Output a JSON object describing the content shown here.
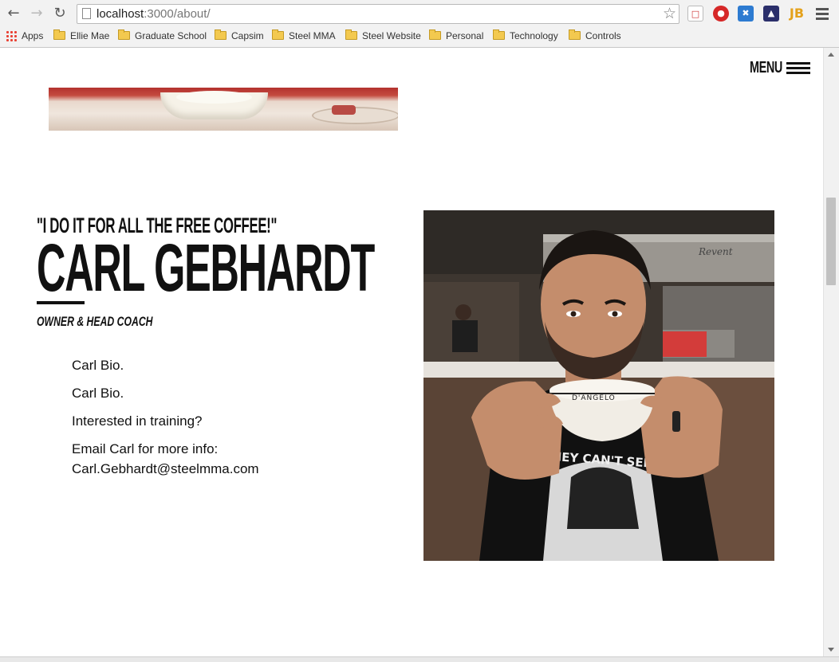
{
  "browser": {
    "url_host": "localhost",
    "url_path": ":3000/about/",
    "bookmarks": [
      {
        "label": "Apps",
        "icon": "apps-grid-icon"
      },
      {
        "label": "Ellie Mae",
        "icon": "folder-icon"
      },
      {
        "label": "Graduate School",
        "icon": "folder-icon"
      },
      {
        "label": "Capsim",
        "icon": "folder-icon"
      },
      {
        "label": "Steel MMA",
        "icon": "folder-icon"
      },
      {
        "label": "Steel Website",
        "icon": "folder-icon"
      },
      {
        "label": "Personal",
        "icon": "folder-icon"
      },
      {
        "label": "Technology",
        "icon": "folder-icon"
      },
      {
        "label": "Controls",
        "icon": "folder-icon"
      }
    ],
    "extensions": [
      "pdf-extension-icon",
      "adblock-icon",
      "x-extension-icon",
      "dark-extension-icon",
      "jetbrains-icon"
    ],
    "jb_label": "JB"
  },
  "nav": {
    "menu_label": "MENU"
  },
  "profile": {
    "quote": "\"I DO IT FOR ALL THE FREE COFFEE!\"",
    "name": "CARL GEBHARDT",
    "role": "OWNER & HEAD COACH",
    "bio": [
      "Carl Bio.",
      "Carl Bio.",
      "Interested in training?",
      "Email Carl for more info: Carl.Gebhardt@steelmma.com"
    ]
  },
  "photo": {
    "cup_text": "D'ANGELO",
    "shirt_text": "THEY CAN'T SEE ME",
    "sign_text": "Revent"
  },
  "colors": {
    "text": "#111111",
    "page_bg": "#ffffff"
  }
}
